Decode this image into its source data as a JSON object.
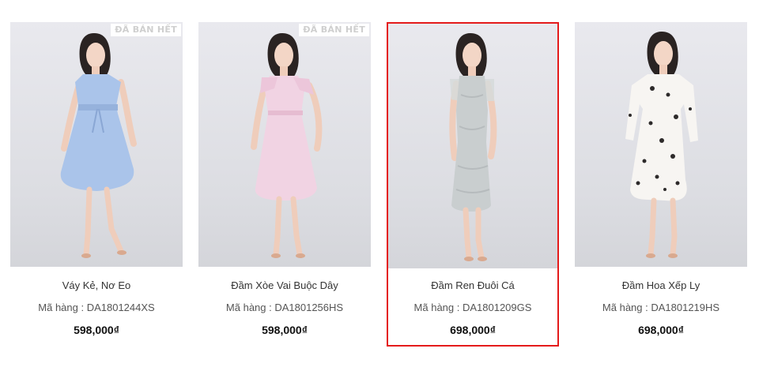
{
  "products": [
    {
      "name": "Váy Kẻ, Nơ Eo",
      "sku": "Mã hàng : DA1801244XS",
      "price": "598,000₫",
      "badge": "ĐÃ BÁN HẾT",
      "dress_color": "#aac4ea",
      "selected": false
    },
    {
      "name": "Đầm Xòe Vai Buộc Dây",
      "sku": "Mã hàng : DA1801256HS",
      "price": "598,000₫",
      "badge": "ĐÃ BÁN HẾT",
      "dress_color": "#f1d3e3",
      "selected": false
    },
    {
      "name": "Đầm Ren Đuôi Cá",
      "sku": "Mã hàng : DA1801209GS",
      "price": "698,000₫",
      "badge": "",
      "dress_color": "#c9cecf",
      "selected": true
    },
    {
      "name": "Đầm Hoa Xếp Ly",
      "sku": "Mã hàng : DA1801219HS",
      "price": "698,000₫",
      "badge": "",
      "dress_color": "#f7f5f2",
      "selected": false
    }
  ],
  "colors": {
    "selection_border": "#e41b1b",
    "photo_background": "#e0e1e6",
    "badge_text": "#cfcfcf"
  }
}
